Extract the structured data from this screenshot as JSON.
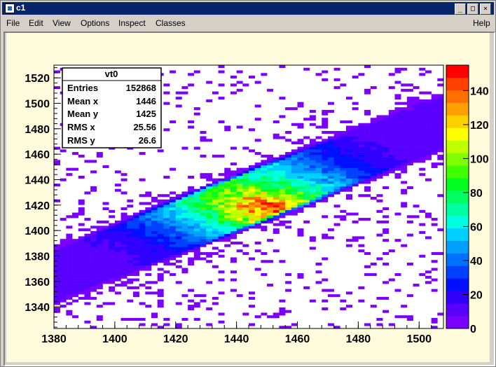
{
  "window": {
    "title": "c1"
  },
  "menu": {
    "file": "File",
    "edit": "Edit",
    "view": "View",
    "options": "Options",
    "inspect": "Inspect",
    "classes": "Classes",
    "help": "Help"
  },
  "window_buttons": {
    "minimize": "_",
    "maximize": "□",
    "close": "×"
  },
  "stats": {
    "title": "vt0",
    "rows": [
      {
        "label": "Entries",
        "value": "152868"
      },
      {
        "label": "Mean x",
        "value": "1446"
      },
      {
        "label": "Mean y",
        "value": "1425"
      },
      {
        "label": "RMS x",
        "value": "25.56"
      },
      {
        "label": "RMS y",
        "value": "26.6"
      }
    ]
  },
  "chart_data": {
    "type": "heatmap",
    "title": "",
    "xlabel": "",
    "ylabel": "",
    "xlim": [
      1380,
      1508
    ],
    "ylim": [
      1323,
      1530
    ],
    "zlim": [
      0,
      155
    ],
    "x_ticks": [
      1380,
      1400,
      1420,
      1440,
      1460,
      1480,
      1500
    ],
    "y_ticks": [
      1340,
      1360,
      1380,
      1400,
      1420,
      1440,
      1460,
      1480,
      1500,
      1520
    ],
    "z_ticks": [
      0,
      20,
      40,
      60,
      80,
      100,
      120,
      140
    ],
    "bins_x": 64,
    "bins_y": 100,
    "distribution": {
      "band_slope": 0.95,
      "band_center": [
        1444,
        1425
      ],
      "band_halfwidth_perpendicular": 14,
      "peak_location": [
        1450,
        1418
      ],
      "peak_content": 150
    },
    "palette": [
      "#7a00ff",
      "#5a00ff",
      "#3000ff",
      "#0010ff",
      "#0040ff",
      "#0070ff",
      "#00a0ff",
      "#00d0ff",
      "#00ffe0",
      "#00ffa0",
      "#00ff60",
      "#00ff20",
      "#40ff00",
      "#80ff00",
      "#c0ff00",
      "#ffff00",
      "#ffd000",
      "#ffa000",
      "#ff7000",
      "#ff4000",
      "#ff0000"
    ]
  }
}
